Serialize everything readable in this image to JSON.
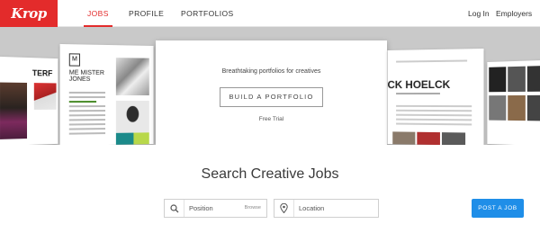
{
  "brand": {
    "logo_text": "Krop",
    "accent": "#e32b2b"
  },
  "nav": {
    "tabs": [
      {
        "label": "JOBS",
        "active": true
      },
      {
        "label": "PROFILE",
        "active": false
      },
      {
        "label": "PORTFOLIOS",
        "active": false
      }
    ],
    "right_links": [
      {
        "label": "Log In"
      },
      {
        "label": "Employers"
      }
    ]
  },
  "hero": {
    "tagline": "Breathtaking portfolios for creatives",
    "cta_label": "BUILD A PORTFOLIO",
    "trial_text": "Free Trial",
    "sample_cards": [
      {
        "heading": "TERF"
      },
      {
        "heading": "ME MISTER JONES",
        "mark": "M"
      },
      {
        "heading": "CK HOELCK"
      }
    ]
  },
  "search": {
    "headline": "Search Creative Jobs",
    "position_placeholder": "Position",
    "browse_label": "Browse",
    "location_placeholder": "Location",
    "post_button_label": "POST A JOB",
    "button_color": "#1f8ee8"
  }
}
